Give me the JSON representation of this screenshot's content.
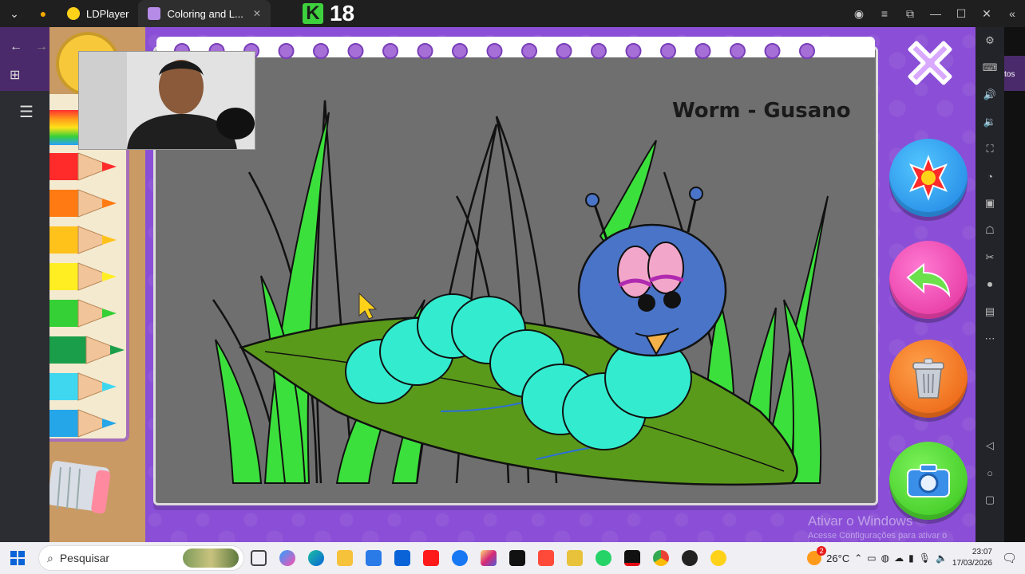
{
  "titlebar": {
    "tabs": [
      {
        "label": "LDPlayer"
      },
      {
        "label": "Coloring and L..."
      }
    ],
    "brand_score": "18"
  },
  "game": {
    "picture_title": "Worm - Gusano",
    "crayon_colors": [
      "#ff2a2a",
      "#ff7a12",
      "#ffc21a",
      "#ffee22",
      "#35d035",
      "#1a9e4a",
      "#3fd7f0",
      "#25a6e8"
    ],
    "picture_colors": {
      "background": "#6f6f6f",
      "grass": "#3ce03c",
      "leaf": "#5a9a1a",
      "worm_body": "#33eccf",
      "worm_head": "#4a74c8"
    },
    "buttons": [
      "close-button",
      "colour-burst-button",
      "undo-button",
      "trash-button",
      "camera-button"
    ]
  },
  "watermark": {
    "line1": "Ativar o Windows",
    "line2": "Acesse Configurações para ativar o Windows."
  },
  "right_strip_text": "tos",
  "taskbar": {
    "search_placeholder": "Pesquisar",
    "weather_temp": "26°C",
    "weather_badge": "2",
    "time": "23:07",
    "date": "17/03/2026"
  }
}
